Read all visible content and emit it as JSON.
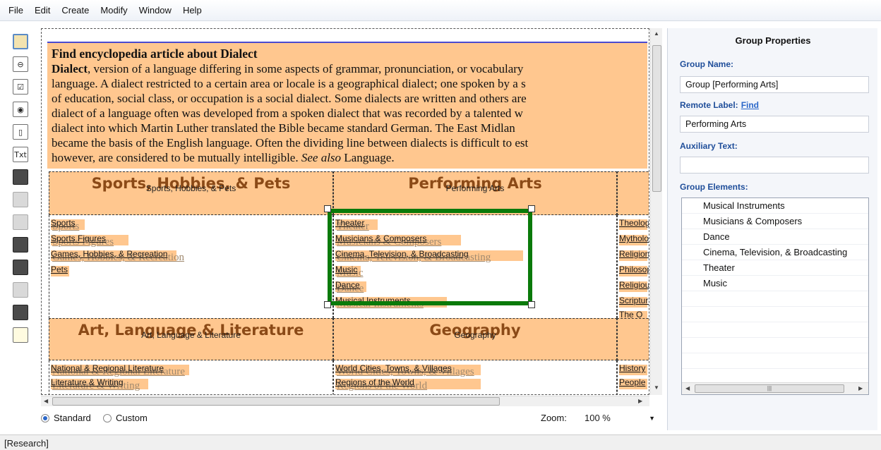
{
  "menu": [
    "File",
    "Edit",
    "Create",
    "Modify",
    "Window",
    "Help"
  ],
  "toolbar": {
    "txt_label": "Txt"
  },
  "article": {
    "title": "Find encyclopedia article about Dialect",
    "lines": [
      [
        "Dialect",
        ", version of a language differing in some aspects of grammar, pronunciation, or vocabulary"
      ],
      [
        "",
        "language. A dialect restricted to a certain area or locale is a geographical dialect; one spoken by a s"
      ],
      [
        "",
        "of education, social class, or occupation is a social dialect. Some dialects are written and others are"
      ],
      [
        "",
        "dialect of a language often was developed from a spoken dialect that was recorded by a talented w"
      ],
      [
        "",
        "dialect into which Martin Luther translated the Bible became standard German. The East Midlan"
      ],
      [
        "",
        "became the basis of the English language. Often the dividing line between dialects is difficult to est"
      ]
    ],
    "last_line_prefix": "however, are considered to be mutually intelligible. ",
    "last_line_italic": "See also",
    "last_line_suffix": " Language."
  },
  "groups": {
    "sports": {
      "title": "Sports, Hobbies, & Pets",
      "subtitle": "Sports, Hobbies, & Pets",
      "items": [
        "Sports",
        "Sports Figures",
        "Games, Hobbies, & Recreation",
        "Pets"
      ]
    },
    "performing": {
      "title": "Performing Arts",
      "subtitle": "Performing Arts",
      "items": [
        "Theater",
        "Musicians & Composers",
        "Cinema, Television, & Broadcasting",
        "Music",
        "Dance",
        "Musical Instruments"
      ]
    },
    "religion": {
      "items": [
        "Theology",
        "Mythology",
        "Religion",
        "Philosophy",
        "Religious",
        "Scriptures",
        "The O"
      ]
    },
    "art": {
      "title": "Art, Language & Literature",
      "subtitle": "Art, Language & Literature",
      "items": [
        "National & Regional Literature",
        "Literature & Writing"
      ]
    },
    "geography": {
      "title": "Geography",
      "subtitle": "Geography",
      "items": [
        "World Cities, Towns, & Villages",
        "Regions of the World"
      ]
    },
    "history": {
      "items": [
        "History",
        "People"
      ]
    }
  },
  "bottom": {
    "standard": "Standard",
    "custom": "Custom",
    "zoom_label": "Zoom:",
    "zoom_value": "100 %"
  },
  "status": "[Research]",
  "panel": {
    "title": "Group Properties",
    "group_name_label": "Group Name:",
    "group_name_value": "Group [Performing Arts]",
    "remote_label": "Remote Label:",
    "remote_find": "Find",
    "remote_value": "Performing Arts",
    "aux_label": "Auxiliary Text:",
    "aux_value": "",
    "elements_label": "Group Elements:",
    "elements": [
      "Musical Instruments",
      "Musicians & Composers",
      "Dance",
      "Cinema, Television, & Broadcasting",
      "Theater",
      "Music"
    ]
  },
  "colors": {
    "group_fill": "#ffc78f",
    "group_title": "#8b4a17",
    "selection": "#0a7a0a",
    "label_blue": "#1f4e9a"
  }
}
